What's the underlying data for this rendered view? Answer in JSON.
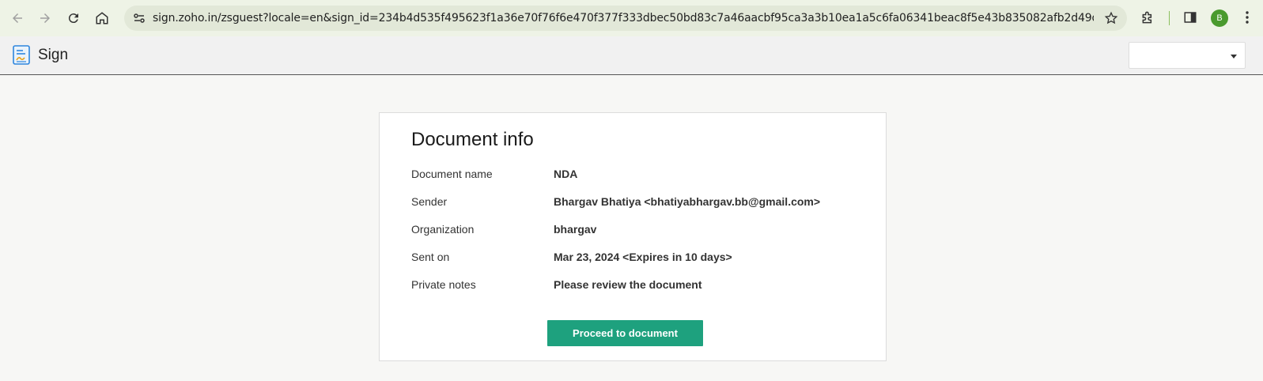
{
  "browser": {
    "url": "sign.zoho.in/zsguest?locale=en&sign_id=234b4d535f495623f1a36e70f76f6e470f377f333dbec50bd83c7a46aacbf95ca3a3b10ea1a5c6fa06341beac8f5e43b835082afb2d49d062c2b4116fc6117d5...",
    "profile_initial": "B",
    "icons": [
      "back-icon",
      "forward-icon",
      "reload-icon",
      "home-icon",
      "site-info-icon",
      "star-icon",
      "extensions-icon",
      "side-panel-icon",
      "menu-icon"
    ],
    "accent_color": "#4a9a2e"
  },
  "app": {
    "title": "Sign",
    "logo_icon": "zoho-sign-logo-icon",
    "language_select_value": ""
  },
  "document_info": {
    "title": "Document info",
    "rows": [
      {
        "label": "Document name",
        "value": "NDA"
      },
      {
        "label": "Sender",
        "value": "Bhargav Bhatiya <bhatiyabhargav.bb@gmail.com>"
      },
      {
        "label": "Organization",
        "value": "bhargav"
      },
      {
        "label": "Sent on",
        "value": "Mar 23, 2024 <Expires in 10 days>"
      },
      {
        "label": "Private notes",
        "value": "Please review the document"
      }
    ],
    "proceed_label": "Proceed to document",
    "button_color": "#1ea17e"
  }
}
